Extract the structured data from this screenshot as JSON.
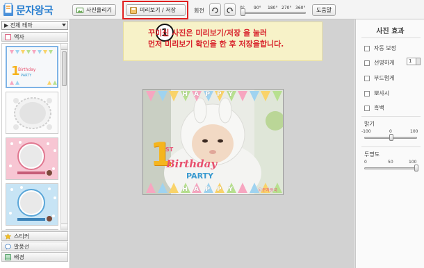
{
  "app": {
    "logo_text": "문자왕국",
    "colors": {
      "accent": "#2a7fd0",
      "highlight": "#e02020",
      "callout_text": "#d8262e",
      "callout_bg": "#f7f2c8"
    }
  },
  "toolbar": {
    "upload_label": "사진올리기",
    "preview_save_label": "미리보기 / 저장",
    "rotate_label": "회전",
    "rotate_ticks": [
      "0°",
      "90°",
      "180°",
      "270°",
      "360°"
    ],
    "rotate_value_deg": 0,
    "help_label": "도움말"
  },
  "left_panel": {
    "theme_select": "▶ 전체 테마",
    "category_frame": "액자",
    "bottom_categories": [
      "스티커",
      "말풍선",
      "배경"
    ],
    "selected_thumb_index": 0
  },
  "callout": {
    "number": "1",
    "text": "꾸미신 사진은 미리보기/저장 을 눌러\n먼저 미리보기 확인을 한 후 저장을합니다."
  },
  "photo": {
    "banner_letters": [
      "H",
      "A",
      "P",
      "P",
      "Y"
    ],
    "big_number": "1",
    "superscript": "ST",
    "title": "Birthday",
    "subtitle": "PARTY",
    "watermark": "ⓒ문자왕국"
  },
  "right_panel": {
    "title": "사진 효과",
    "checkboxes": [
      "자동 보정",
      "선명하게",
      "부드럽게",
      "뽀샤시",
      "흑백"
    ],
    "sharpen_value": "1",
    "brightness": {
      "label": "밝기",
      "min": "-100",
      "mid": "0",
      "max": "100",
      "value": 0
    },
    "opacity": {
      "label": "투명도",
      "min": "0",
      "mid": "50",
      "max": "100",
      "value": 100
    }
  }
}
